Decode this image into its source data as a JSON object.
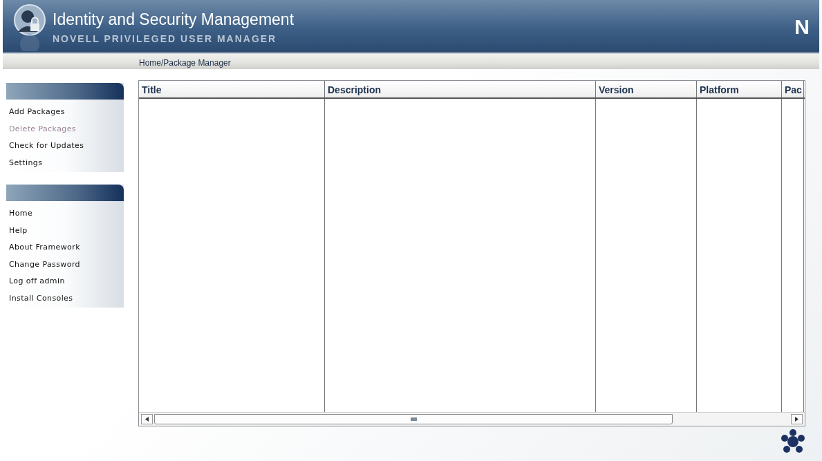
{
  "header": {
    "title": "Identity and Security Management",
    "subtitle": "NOVELL PRIVILEGED USER MANAGER",
    "logo": "N"
  },
  "breadcrumb": "Home/Package Manager",
  "sidebar": [
    {
      "items": [
        {
          "label": "Add Packages",
          "disabled": false
        },
        {
          "label": "Delete Packages",
          "disabled": true
        },
        {
          "label": "Check for Updates",
          "disabled": false
        },
        {
          "label": "Settings",
          "disabled": false
        }
      ]
    },
    {
      "items": [
        {
          "label": "Home",
          "disabled": false
        },
        {
          "label": "Help",
          "disabled": false
        },
        {
          "label": "About Framework",
          "disabled": false
        },
        {
          "label": "Change Password",
          "disabled": false
        },
        {
          "label": "Log off admin",
          "disabled": false
        },
        {
          "label": "Install Consoles",
          "disabled": false
        }
      ]
    }
  ],
  "table": {
    "columns": [
      "Title",
      "Description",
      "Version",
      "Platform",
      "Pac"
    ]
  }
}
